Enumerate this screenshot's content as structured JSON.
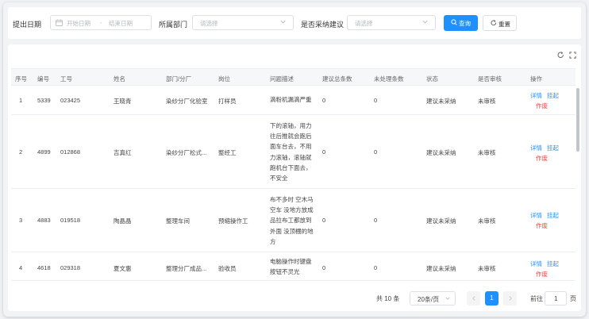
{
  "filters": {
    "date_label": "提出日期",
    "date_start_placeholder": "开始日期",
    "date_separator": "-",
    "date_end_placeholder": "结束日期",
    "dept_label": "所属部门",
    "dept_placeholder": "请选择",
    "adopt_label": "是否采纳建议",
    "adopt_placeholder": "请选择",
    "query_label": "查询",
    "reset_label": "重置"
  },
  "table": {
    "headers": [
      "序号",
      "编号",
      "工号",
      "姓名",
      "部门/分厂",
      "岗位",
      "问题描述",
      "建议总条数",
      "未处理条数",
      "状态",
      "是否审核",
      "操作"
    ],
    "rows": [
      {
        "no": "1",
        "code": "5339",
        "emp": "023425",
        "name": "王晓青",
        "dept": "染纱分厂化验室",
        "post": "打样员",
        "desc": "滴粉机漏滴严重",
        "total": "0",
        "pending": "0",
        "status": "建议未采纳",
        "audit": "未审核"
      },
      {
        "no": "2",
        "code": "4899",
        "emp": "012868",
        "name": "吉真红",
        "dept": "染纱分厂松式...",
        "post": "整经工",
        "desc": "下的滚轴，用力往后推就会跑后面车台去，不用力滚轴，滚轴就跑机台下面去，不安全",
        "total": "0",
        "pending": "0",
        "status": "建议未采纳",
        "audit": "未审核"
      },
      {
        "no": "3",
        "code": "4883",
        "emp": "019518",
        "name": "陶晶晶",
        "dept": "整理车间",
        "post": "预缩操作工",
        "desc": "布不多时 空木马空车 没地方放成品拉布工都放到外面 没顶棚的地方",
        "total": "0",
        "pending": "0",
        "status": "建议未采纳",
        "audit": "未审核"
      },
      {
        "no": "4",
        "code": "4618",
        "emp": "029318",
        "name": "夏文惠",
        "dept": "整理分厂成品...",
        "post": "验收员",
        "desc": "电脑操作时键盘按钮不灵光",
        "total": "0",
        "pending": "0",
        "status": "建议未采纳",
        "audit": "未审核"
      }
    ],
    "actions": {
      "detail": "详情",
      "suspend": "挂起",
      "void": "作废"
    }
  },
  "pagination": {
    "total_text": "共 10 条",
    "page_size": "20条/页",
    "current_page": "1",
    "goto_label": "前往",
    "goto_value": "1",
    "page_unit": "页"
  },
  "colors": {
    "primary": "#1e90ff",
    "danger": "#f04438"
  },
  "icons": [
    "calendar-icon",
    "chevron-down-icon",
    "search-icon",
    "refresh-icon",
    "fullscreen-icon",
    "chevron-left-icon",
    "chevron-right-icon"
  ]
}
